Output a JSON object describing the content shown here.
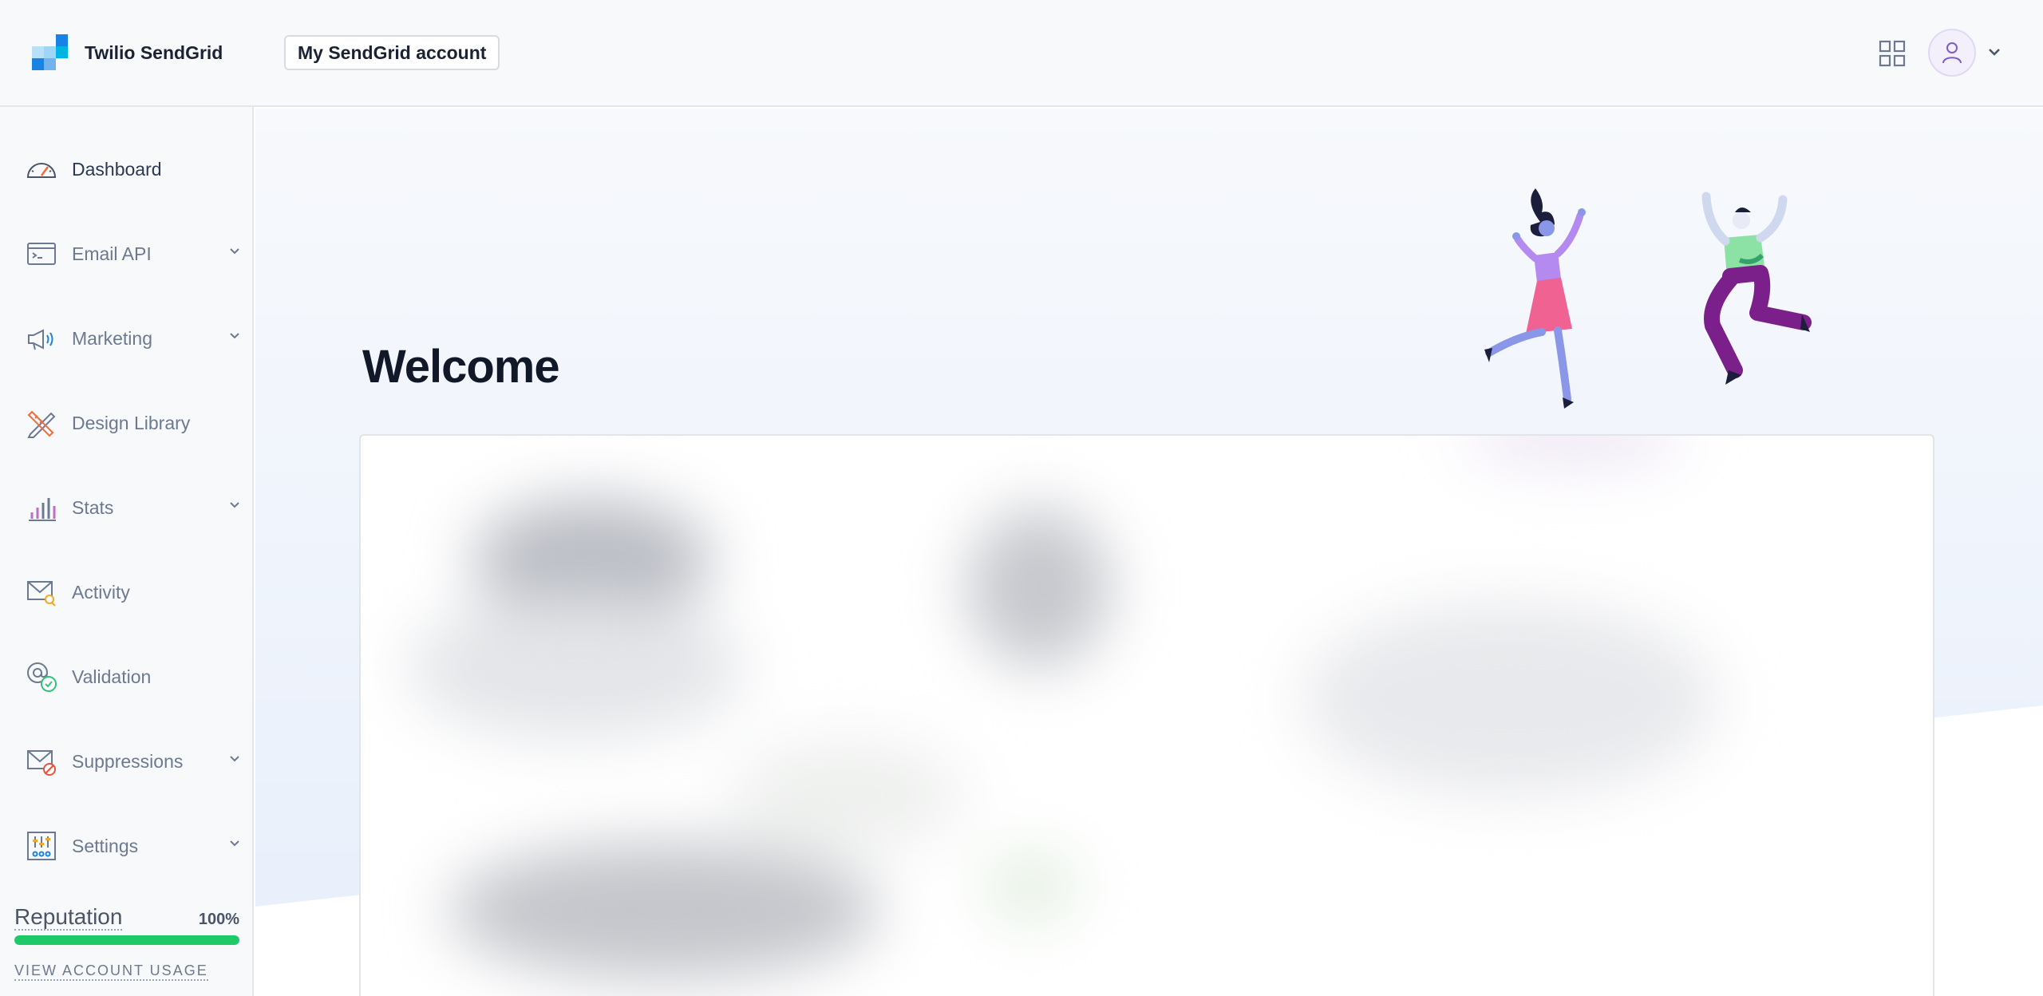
{
  "header": {
    "brand_name": "Twilio SendGrid",
    "account_button": "My SendGrid account",
    "icons": [
      "sendgrid-logo",
      "apps-grid-icon",
      "user-icon",
      "chevron-down-icon"
    ]
  },
  "sidebar": {
    "items": [
      {
        "label": "Dashboard",
        "icon": "speedometer-icon",
        "active": true,
        "has_submenu": false
      },
      {
        "label": "Email API",
        "icon": "code-window-icon",
        "active": false,
        "has_submenu": true
      },
      {
        "label": "Marketing",
        "icon": "megaphone-icon",
        "active": false,
        "has_submenu": true
      },
      {
        "label": "Design Library",
        "icon": "pencil-ruler-icon",
        "active": false,
        "has_submenu": false
      },
      {
        "label": "Stats",
        "icon": "bar-chart-icon",
        "active": false,
        "has_submenu": true
      },
      {
        "label": "Activity",
        "icon": "envelope-search-icon",
        "active": false,
        "has_submenu": false
      },
      {
        "label": "Validation",
        "icon": "at-check-icon",
        "active": false,
        "has_submenu": false
      },
      {
        "label": "Suppressions",
        "icon": "envelope-block-icon",
        "active": false,
        "has_submenu": true
      },
      {
        "label": "Settings",
        "icon": "sliders-icon",
        "active": false,
        "has_submenu": true
      }
    ],
    "reputation": {
      "label": "Reputation",
      "percent_text": "100%",
      "value": 1.0,
      "bar_color": "#1ec96a"
    },
    "usage_link": "VIEW ACCOUNT USAGE"
  },
  "main": {
    "title": "Welcome"
  },
  "colors": {
    "accent_blue": "#1a82e2",
    "brand_dark_blue": "#263746",
    "sidebar_bg": "#f8f9fa",
    "text_dark": "#111827"
  }
}
